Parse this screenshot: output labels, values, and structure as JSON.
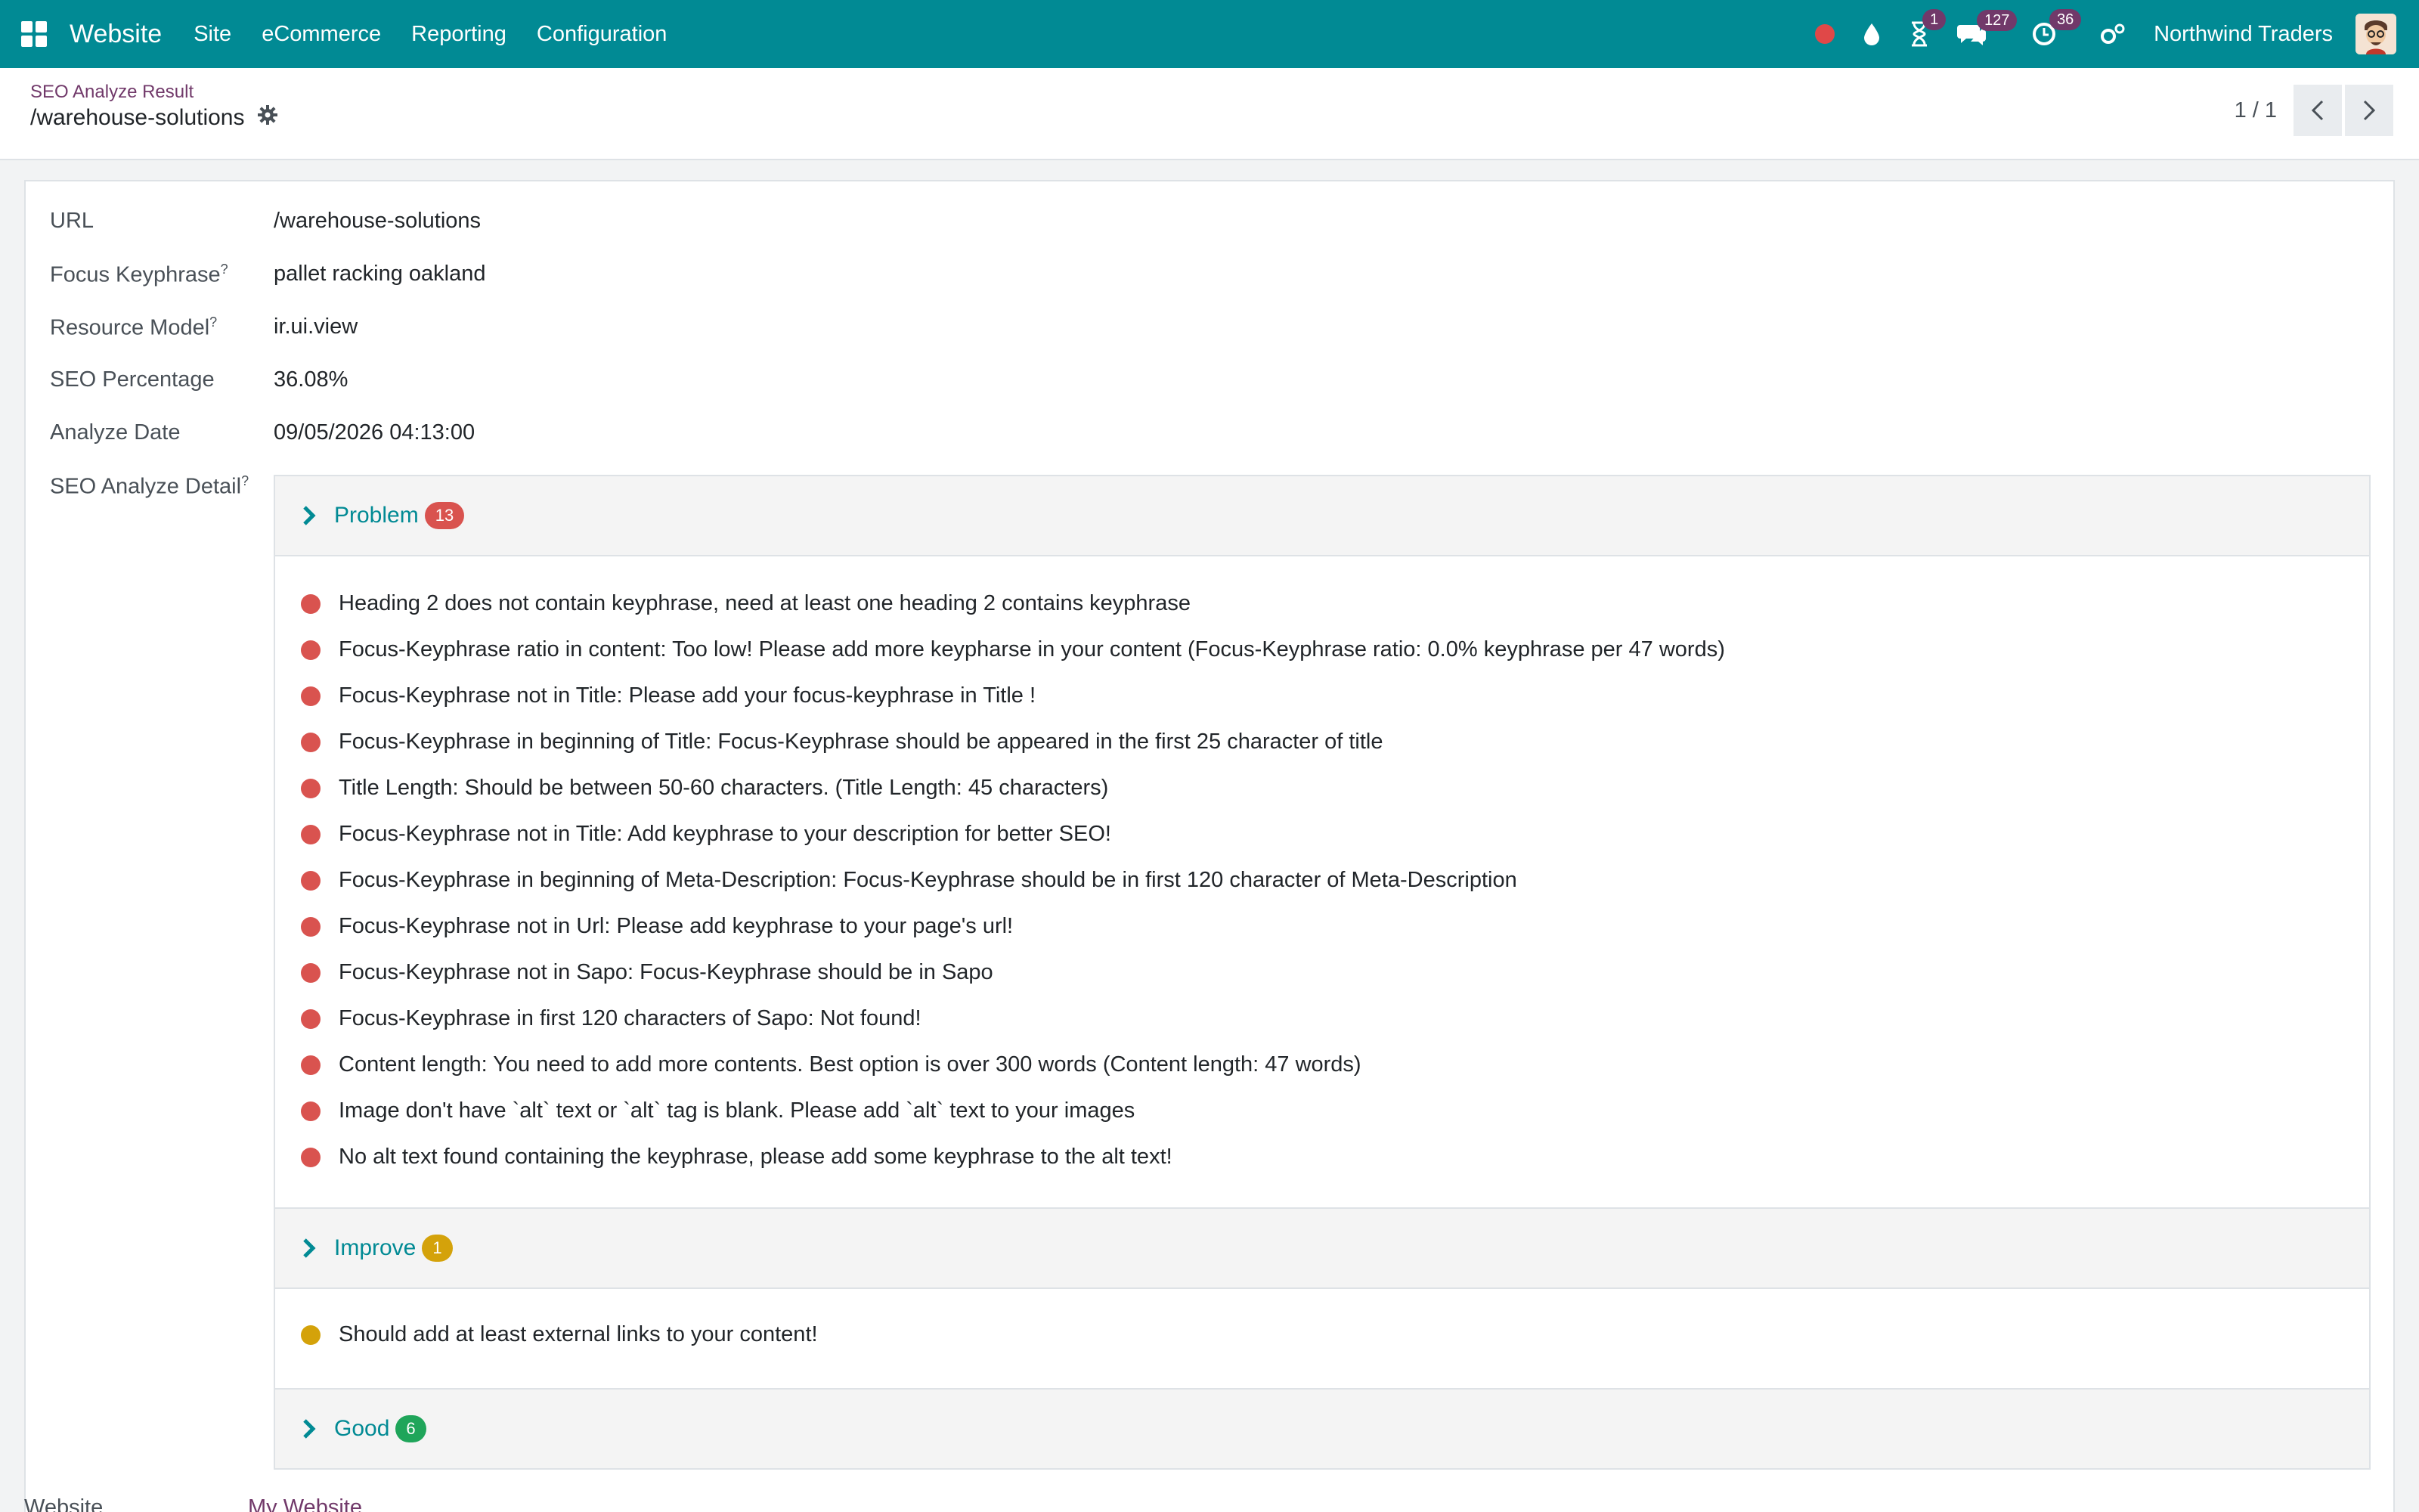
{
  "navbar": {
    "app_name": "Website",
    "menu": [
      "Site",
      "eCommerce",
      "Reporting",
      "Configuration"
    ],
    "activity_count": "1",
    "messages_count": "127",
    "timer_count": "36",
    "company": "Northwind Traders",
    "color": "#018a94"
  },
  "control_panel": {
    "breadcrumb": "SEO Analyze Result",
    "record_title": "/warehouse-solutions",
    "pager": "1 / 1"
  },
  "form": {
    "fields": [
      {
        "label": "URL",
        "value": "/warehouse-solutions",
        "help": ""
      },
      {
        "label": "Focus Keyphrase",
        "value": "pallet racking oakland",
        "help": "?"
      },
      {
        "label": "Resource Model",
        "value": "ir.ui.view",
        "help": "?"
      },
      {
        "label": "SEO Percentage",
        "value": "36.08%",
        "help": ""
      },
      {
        "label": "Analyze Date",
        "value": "09/05/2026 04:13:00",
        "help": ""
      }
    ],
    "detail_label": "SEO Analyze Detail",
    "detail_help": "?",
    "website_label": "Website",
    "website_value": "My Website"
  },
  "sections": {
    "problem": {
      "title": "Problem",
      "count": "13",
      "color": "#d9534f",
      "items": [
        "Heading 2 does not contain keyphrase, need at least one heading 2 contains keyphrase",
        "Focus-Keyphrase ratio in content: Too low! Please add more keypharse in your content (Focus-Keyphrase ratio: 0.0% keyphrase per 47 words)",
        "Focus-Keyphrase not in Title: Please add your focus-keyphrase in Title !",
        "Focus-Keyphrase in beginning of Title: Focus-Keyphrase should be appeared in the first 25 character of title",
        "Title Length: Should be between 50-60 characters. (Title Length: 45 characters)",
        "Focus-Keyphrase not in Title: Add keyphrase to your description for better SEO!",
        "Focus-Keyphrase in beginning of Meta-Description: Focus-Keyphrase should be in first 120 character of Meta-Description",
        "Focus-Keyphrase not in Url: Please add keyphrase to your page's url!",
        "Focus-Keyphrase not in Sapo: Focus-Keyphrase should be in Sapo",
        "Focus-Keyphrase in first 120 characters of Sapo: Not found!",
        "Content length: You need to add more contents. Best option is over 300 words (Content length: 47 words)",
        "Image don't have `alt` text or `alt` tag is blank. Please add `alt` text to your images",
        "No alt text found containing the keyphrase, please add some keyphrase to the alt text!"
      ]
    },
    "improve": {
      "title": "Improve",
      "count": "1",
      "color": "#d4a20a",
      "items": [
        "Should add at least external links to your content!"
      ]
    },
    "good": {
      "title": "Good",
      "count": "6",
      "color": "#1fa55a"
    }
  }
}
